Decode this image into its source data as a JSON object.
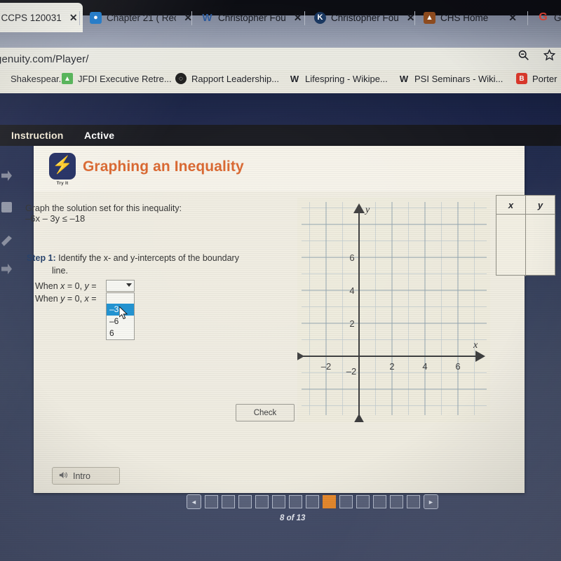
{
  "browser": {
    "tabs": [
      {
        "title": "C CCPS 120031",
        "favicon_letter": "",
        "favicon_color": "#ffffff",
        "active": true
      },
      {
        "title": "Chapter 21 ( Rec",
        "favicon_letter": "■",
        "favicon_color": "#1a73c8",
        "active": false
      },
      {
        "title": "Christopher Fou",
        "favicon_letter": "W",
        "favicon_color": "#2a5699",
        "active": false
      },
      {
        "title": "Christopher Fou",
        "favicon_letter": "K",
        "favicon_color": "#18355e",
        "active": false
      },
      {
        "title": "CHS Home",
        "favicon_letter": "▲",
        "favicon_color": "#8c4a1e",
        "active": false
      },
      {
        "title": "G",
        "favicon_letter": "G",
        "favicon_color": "#ea4335",
        "active": false
      }
    ],
    "tab_close_label": "✕",
    "url": "genuity.com/Player/",
    "toolbar_icons": [
      "zoom-out-icon",
      "bookmark-star-icon"
    ],
    "bookmarks": [
      {
        "label": "Shakespear...",
        "favicon_letter": "",
        "favicon_color": "transparent"
      },
      {
        "label": "JFDI Executive Retre...",
        "favicon_letter": "▲",
        "favicon_color": "#4caf50"
      },
      {
        "label": "Rapport Leadership...",
        "favicon_letter": "●",
        "favicon_color": "#1b1b1b"
      },
      {
        "label": "Lifespring - Wikipe...",
        "favicon_letter": "W",
        "favicon_color": "transparent"
      },
      {
        "label": "PSI Seminars - Wiki...",
        "favicon_letter": "W",
        "favicon_color": "transparent"
      },
      {
        "label": "Porter",
        "favicon_letter": "B",
        "favicon_color": "#e0382a"
      }
    ]
  },
  "player": {
    "menu_tabs": [
      {
        "label": "Instruction",
        "selected": false
      },
      {
        "label": "Active",
        "selected": true
      }
    ]
  },
  "lesson": {
    "badge_label": "Try It",
    "badge_icon": "lightning-bolt-icon",
    "title": "Graphing an Inequality",
    "prompt": "Graph the solution set for this inequality:",
    "inequality": "–6x – 3y ≤ –18",
    "step_label": "Step 1:",
    "step_text": "Identify the x- and y-intercepts of the boundary",
    "step_text_line2": "line.",
    "rows": [
      {
        "text_before": "When ",
        "var1": "x",
        "mid": " = 0, ",
        "var2": "y",
        "after": " ="
      },
      {
        "text_before": "When ",
        "var1": "y",
        "mid": " = 0, ",
        "var2": "x",
        "after": " ="
      }
    ],
    "dropdown": {
      "value": "",
      "expanded": true,
      "options": [
        "",
        "–3",
        "–6",
        "6"
      ],
      "highlighted": "–3"
    },
    "check_button": "Check",
    "intro_button": "Intro",
    "intro_icon": "speaker-icon"
  },
  "table": {
    "headers": [
      "x",
      "y"
    ],
    "rows": []
  },
  "chart_data": {
    "type": "scatter",
    "title": "",
    "xlabel": "x",
    "ylabel": "y",
    "xlim": [
      -3.4,
      8.2
    ],
    "ylim": [
      -3.6,
      8.2
    ],
    "xticks": [
      -2,
      2,
      4,
      6
    ],
    "yticks": [
      2,
      4,
      6
    ],
    "xtick_labels": [
      "–2",
      "2",
      "4",
      "6"
    ],
    "ytick_labels": [
      "2",
      "4",
      "6"
    ],
    "grid": true,
    "minor_grid_step": 1,
    "major_grid_step": 2,
    "series": [],
    "values": [],
    "categories": [],
    "legend": "none",
    "axis_arrows": true
  },
  "pager": {
    "prev_label": "◄",
    "next_label": "►",
    "total": 13,
    "current": 8,
    "status": "8 of 13"
  },
  "colors": {
    "accent_orange": "#d9622b",
    "pager_active": "#e88a2c",
    "select_highlight": "#1e8fd0",
    "card_bg": "#efece0",
    "badge_navy": "#1e2a5e"
  }
}
